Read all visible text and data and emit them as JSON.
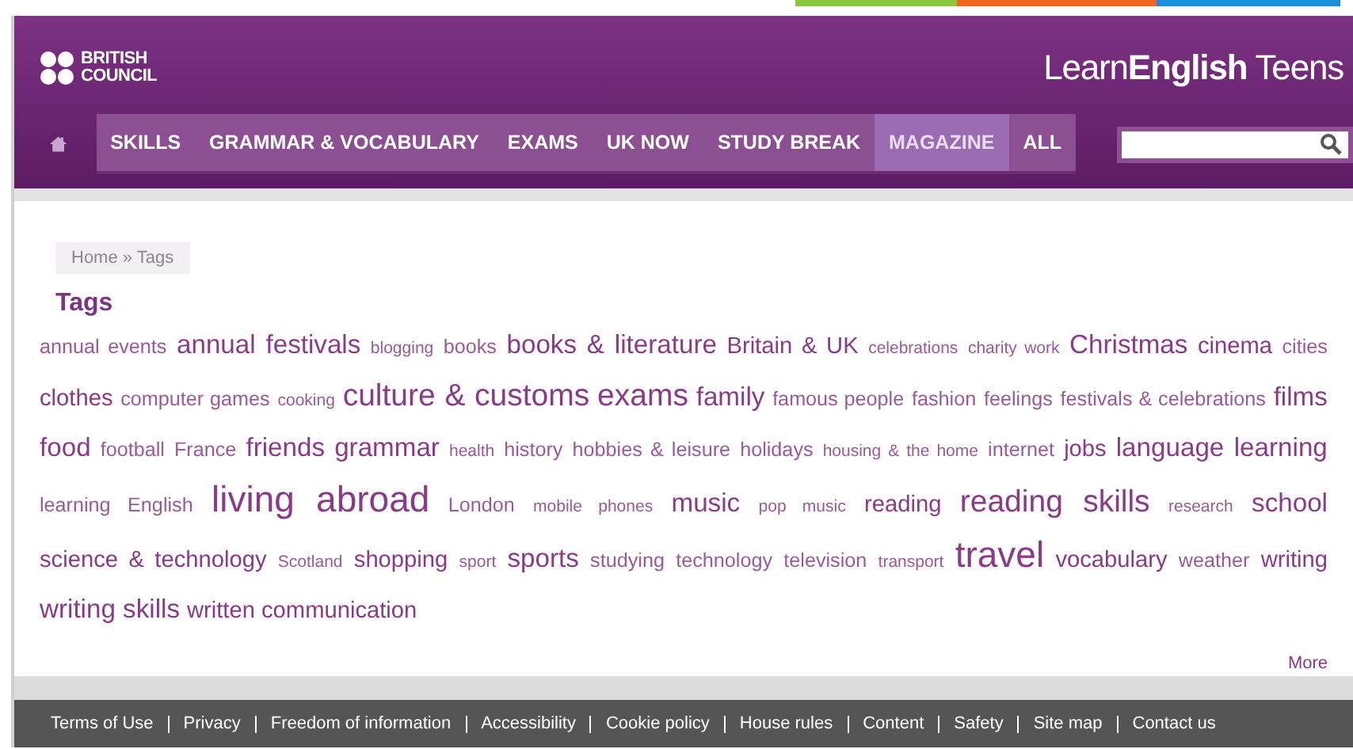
{
  "header": {
    "logo_lines": [
      "BRITISH",
      "COUNCIL"
    ],
    "site_title": "Learn**English** Teens"
  },
  "nav": {
    "items": [
      {
        "label": "SKILLS",
        "selected": false
      },
      {
        "label": "GRAMMAR & VOCABULARY",
        "selected": false
      },
      {
        "label": "EXAMS",
        "selected": false
      },
      {
        "label": "UK NOW",
        "selected": false
      },
      {
        "label": "STUDY BREAK",
        "selected": false
      },
      {
        "label": "MAGAZINE",
        "selected": true
      },
      {
        "label": "ALL",
        "selected": false
      }
    ]
  },
  "breadcrumb": "Home » Tags",
  "heading": "Tags",
  "tags": [
    {
      "label": "annual events",
      "kind": "small"
    },
    {
      "label": "annual festivals",
      "kind": "large"
    },
    {
      "label": "blogging",
      "kind": "tiny"
    },
    {
      "label": "books",
      "kind": "small"
    },
    {
      "label": "books & literature",
      "kind": "large"
    },
    {
      "label": "Britain & UK",
      "kind": "medium"
    },
    {
      "label": "celebrations",
      "kind": "tiny"
    },
    {
      "label": "charity work",
      "kind": "tiny"
    },
    {
      "label": "Christmas",
      "kind": "large"
    },
    {
      "label": "cinema",
      "kind": "medium"
    },
    {
      "label": "cities",
      "kind": "small"
    },
    {
      "label": "clothes",
      "kind": "medium"
    },
    {
      "label": "computer games",
      "kind": "small"
    },
    {
      "label": "cooking",
      "kind": "tiny"
    },
    {
      "label": "culture & customs",
      "kind": "huge"
    },
    {
      "label": "exams",
      "kind": "huge"
    },
    {
      "label": "family",
      "kind": "large"
    },
    {
      "label": "famous people",
      "kind": "small"
    },
    {
      "label": "fashion",
      "kind": "small"
    },
    {
      "label": "feelings",
      "kind": "small"
    },
    {
      "label": "festivals & celebrations",
      "kind": "small"
    },
    {
      "label": "films",
      "kind": "large"
    },
    {
      "label": "food",
      "kind": "large"
    },
    {
      "label": "football",
      "kind": "small"
    },
    {
      "label": "France",
      "kind": "small"
    },
    {
      "label": "friends",
      "kind": "large"
    },
    {
      "label": "grammar",
      "kind": "large"
    },
    {
      "label": "health",
      "kind": "tiny"
    },
    {
      "label": "history",
      "kind": "small"
    },
    {
      "label": "hobbies & leisure",
      "kind": "small"
    },
    {
      "label": "holidays",
      "kind": "small"
    },
    {
      "label": "housing & the home",
      "kind": "tiny"
    },
    {
      "label": "internet",
      "kind": "small"
    },
    {
      "label": "jobs",
      "kind": "medium"
    },
    {
      "label": "language learning",
      "kind": "large"
    },
    {
      "label": "learning English",
      "kind": "small"
    },
    {
      "label": "living abroad",
      "kind": "giant"
    },
    {
      "label": "London",
      "kind": "small"
    },
    {
      "label": "mobile phones",
      "kind": "tiny"
    },
    {
      "label": "music",
      "kind": "large"
    },
    {
      "label": "pop music",
      "kind": "tiny"
    },
    {
      "label": "reading",
      "kind": "medium"
    },
    {
      "label": "reading skills",
      "kind": "huge"
    },
    {
      "label": "research",
      "kind": "tiny"
    },
    {
      "label": "school",
      "kind": "large"
    },
    {
      "label": "science & technology",
      "kind": "medium"
    },
    {
      "label": "Scotland",
      "kind": "tiny"
    },
    {
      "label": "shopping",
      "kind": "medium"
    },
    {
      "label": "sport",
      "kind": "tiny"
    },
    {
      "label": "sports",
      "kind": "large"
    },
    {
      "label": "studying",
      "kind": "small"
    },
    {
      "label": "technology",
      "kind": "small"
    },
    {
      "label": "television",
      "kind": "small"
    },
    {
      "label": "transport",
      "kind": "tiny"
    },
    {
      "label": "travel",
      "kind": "giant"
    },
    {
      "label": "vocabulary",
      "kind": "medium"
    },
    {
      "label": "weather",
      "kind": "small"
    },
    {
      "label": "writing",
      "kind": "medium"
    },
    {
      "label": "writing skills",
      "kind": "large"
    },
    {
      "label": "written communication",
      "kind": "medium"
    }
  ],
  "more_link": "More",
  "footer_links": [
    "Terms of Use",
    "Privacy",
    "Freedom of information",
    "Accessibility",
    "Cookie policy",
    "House rules",
    "Content",
    "Safety",
    "Site map",
    "Contact us"
  ]
}
